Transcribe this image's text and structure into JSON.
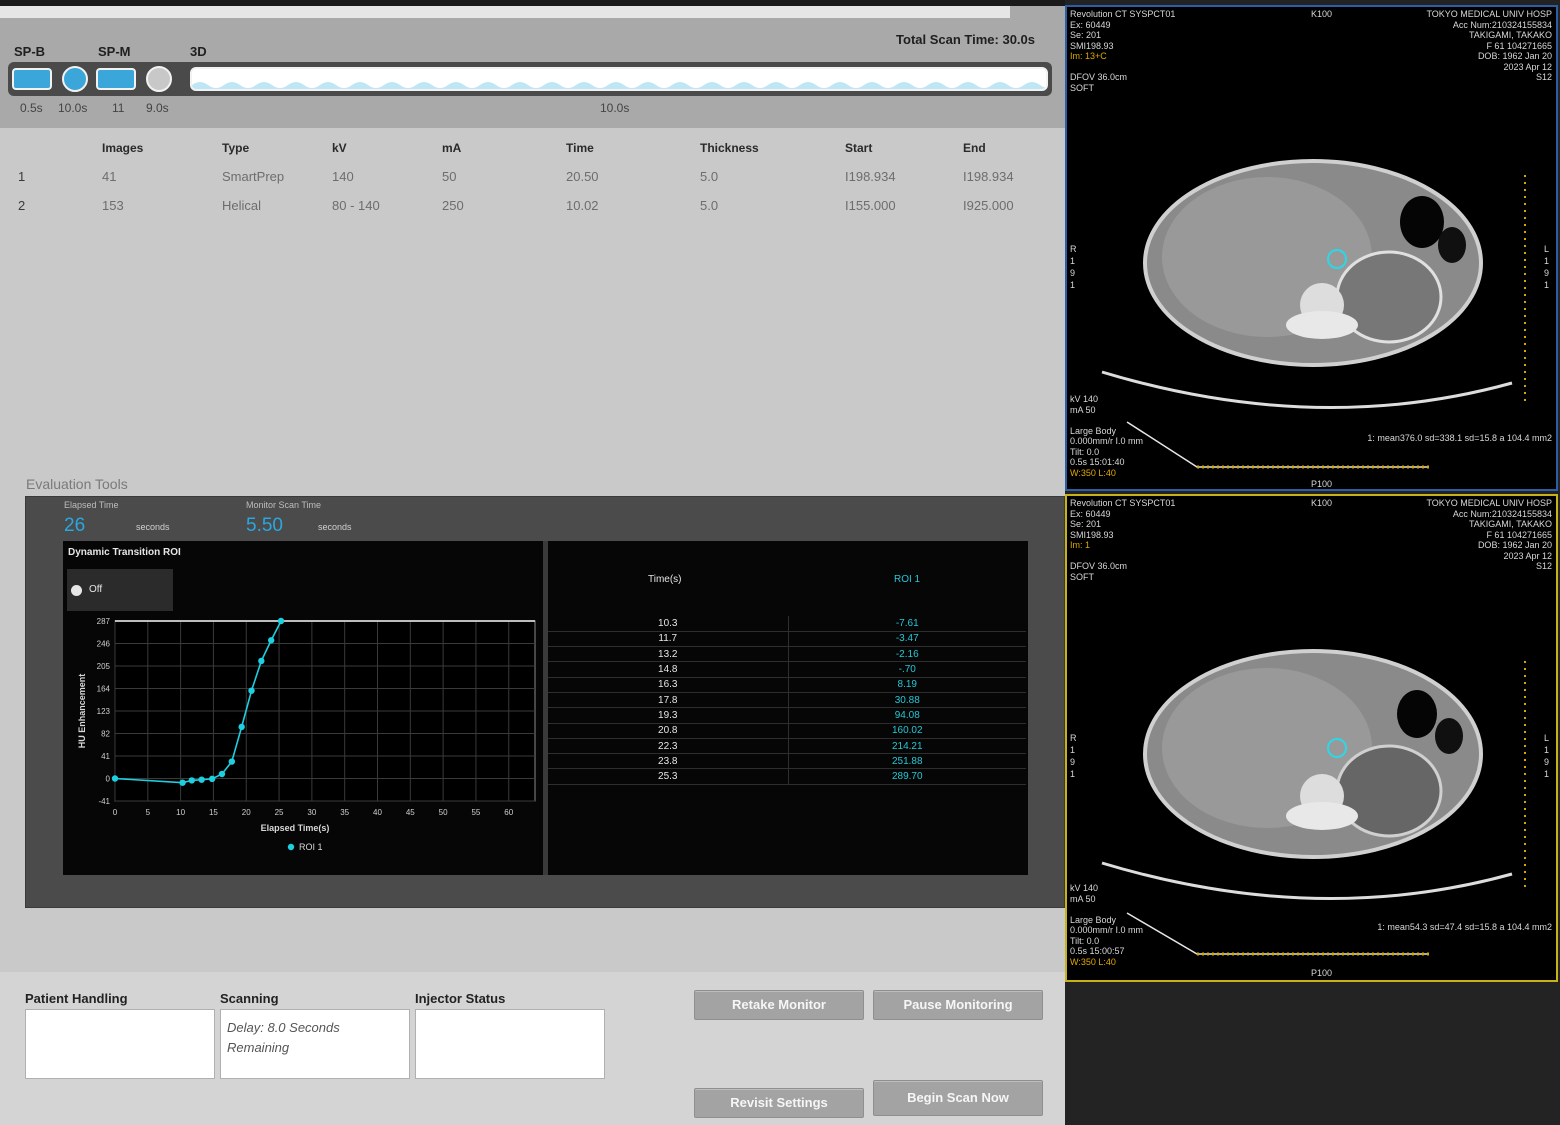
{
  "scan_bar": {
    "segments": [
      {
        "label": "SP-B"
      },
      {
        "label": "SP-M"
      },
      {
        "label": "3D"
      }
    ],
    "total_scan_time": "Total Scan Time: 30.0s",
    "times": [
      "0.5s",
      "10.0s",
      "11",
      "9.0s",
      "10.0s"
    ]
  },
  "protocol": {
    "headers": [
      "",
      "Images",
      "Type",
      "kV",
      "mA",
      "Time",
      "Thickness",
      "Start",
      "End"
    ],
    "rows": [
      [
        "1",
        "41",
        "SmartPrep",
        "140",
        "50",
        "20.50",
        "5.0",
        "I198.934",
        "I198.934"
      ],
      [
        "2",
        "153",
        "Helical",
        "80 - 140",
        "250",
        "10.02",
        "5.0",
        "I155.000",
        "I925.000"
      ]
    ]
  },
  "evaluation": {
    "section_label": "Evaluation Tools",
    "elapsed_time_label": "Elapsed Time",
    "elapsed_time_value": "26",
    "elapsed_time_unit": "seconds",
    "monitor_scan_time_label": "Monitor Scan Time",
    "monitor_scan_time_value": "5.50",
    "monitor_scan_time_unit": "seconds",
    "chart_title": "Dynamic Transition ROI",
    "toggle_label": "Off",
    "table_headers": [
      "Time(s)",
      "ROI 1"
    ],
    "table_rows": [
      [
        "10.3",
        "-7.61"
      ],
      [
        "11.7",
        "-3.47"
      ],
      [
        "13.2",
        "-2.16"
      ],
      [
        "14.8",
        "-.70"
      ],
      [
        "16.3",
        "8.19"
      ],
      [
        "17.8",
        "30.88"
      ],
      [
        "19.3",
        "94.08"
      ],
      [
        "20.8",
        "160.02"
      ],
      [
        "22.3",
        "214.21"
      ],
      [
        "23.8",
        "251.88"
      ],
      [
        "25.3",
        "289.70"
      ]
    ]
  },
  "chart_data": {
    "type": "line",
    "title": "Dynamic Transition ROI",
    "xlabel": "Elapsed Time(s)",
    "ylabel": "HU Enhancement",
    "x_ticks": [
      "0",
      "5",
      "10",
      "15",
      "20",
      "25",
      "30",
      "35",
      "40",
      "45",
      "50",
      "55",
      "60"
    ],
    "y_ticks": [
      "287",
      "246",
      "205",
      "164",
      "123",
      "82",
      "41",
      "0",
      "-41"
    ],
    "xlim": [
      0,
      64
    ],
    "ylim": [
      -41,
      287
    ],
    "grid": true,
    "legend": "bottom",
    "series": [
      {
        "name": "ROI 1",
        "color": "#1ecfe0",
        "x": [
          0,
          10.3,
          11.7,
          13.2,
          14.8,
          16.3,
          17.8,
          19.3,
          20.8,
          22.3,
          23.8,
          25.3
        ],
        "y": [
          0,
          -7.61,
          -3.47,
          -2.16,
          -0.7,
          8.19,
          30.88,
          94.08,
          160.02,
          214.21,
          251.88,
          287
        ]
      }
    ]
  },
  "status": {
    "patient_handling_label": "Patient Handling",
    "scanning_label": "Scanning",
    "scanning_text_1": "Delay: 8.0 Seconds",
    "scanning_text_2": "Remaining",
    "injector_status_label": "Injector Status"
  },
  "buttons": {
    "retake_monitor": "Retake Monitor",
    "pause_monitoring": "Pause Monitoring",
    "revisit_settings": "Revisit Settings",
    "begin_scan_now": "Begin Scan Now"
  },
  "viewers": [
    {
      "tl": [
        "Revolution CT  SYSPCT01",
        "Ex: 60449",
        "Se: 201",
        "SMI198.93",
        "Im: 13+C",
        "",
        "DFOV 36.0cm",
        "SOFT"
      ],
      "tc": "K100",
      "tr": [
        "TOKYO MEDICAL UNIV HOSP",
        "Acc Num:210324155834",
        "TAKIGAMI, TAKAKO",
        "F 61  104271665",
        "DOB: 1962 Jan 20",
        "2023 Apr 12",
        "S12"
      ],
      "left_marker": "R 1 9 1",
      "right_marker": "L 1 9 1",
      "bl": [
        "kV 140",
        "mA 50",
        "",
        "Large Body",
        "0.000mm/r I.0 mm",
        "Tilt: 0.0",
        "0.5s  15:01:40",
        "W:350 L:40"
      ],
      "roi": "1: mean376.0 sd=338.1 sd=15.8 a 104.4 mm2",
      "bottom_center": "P100"
    },
    {
      "tl": [
        "Revolution CT  SYSPCT01",
        "Ex: 60449",
        "Se: 201",
        "SMI198.93",
        "Im: 1",
        "",
        "DFOV 36.0cm",
        "SOFT"
      ],
      "tc": "K100",
      "tr": [
        "TOKYO MEDICAL UNIV HOSP",
        "Acc Num:210324155834",
        "TAKIGAMI, TAKAKO",
        "F 61  104271665",
        "DOB: 1962 Jan 20",
        "2023 Apr 12",
        "S12"
      ],
      "left_marker": "R 1 9 1",
      "right_marker": "L 1 9 1",
      "bl": [
        "kV 140",
        "mA 50",
        "",
        "Large Body",
        "0.000mm/r I.0 mm",
        "Tilt: 0.0",
        "0.5s  15:00:57",
        "W:350 L:40"
      ],
      "roi": "1: mean54.3 sd=47.4 sd=15.8 a 104.4 mm2",
      "bottom_center": "P100"
    }
  ]
}
